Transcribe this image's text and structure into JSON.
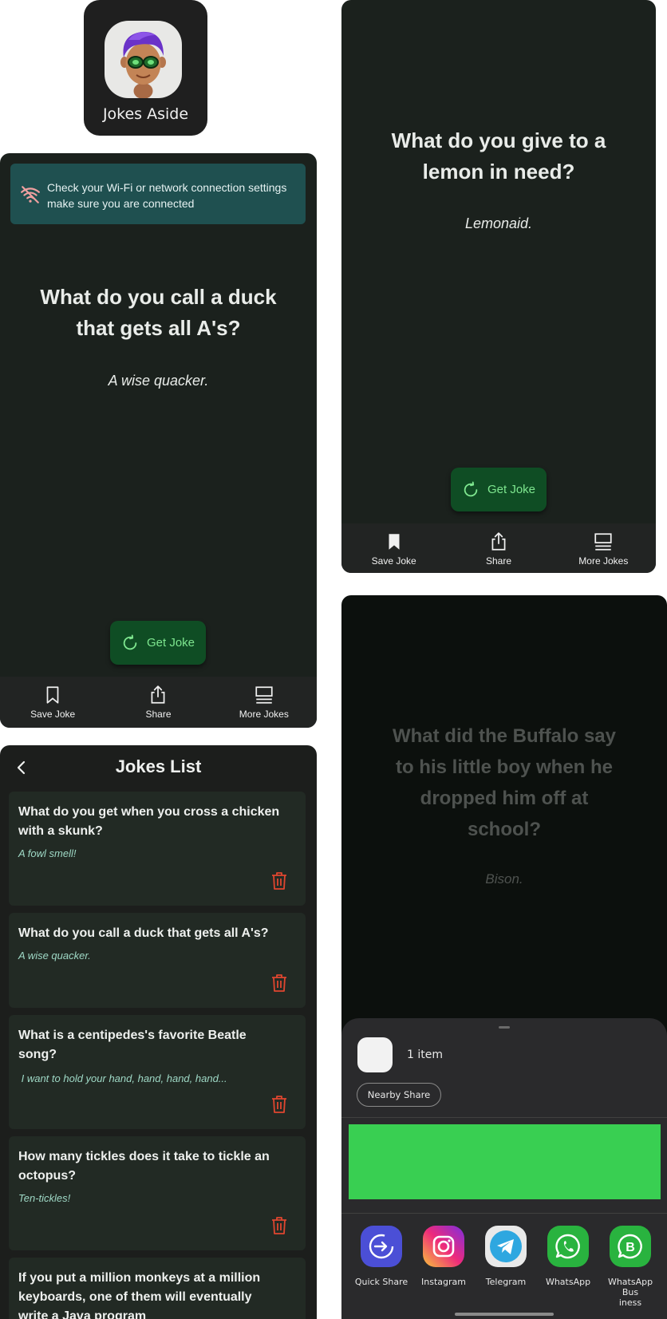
{
  "app_icon": {
    "name": "Jokes Aside"
  },
  "screen_offline": {
    "banner": {
      "line1": "Check your Wi-Fi or network connection settings",
      "line2": "make sure you are connected",
      "accent": "#f0a0a0"
    },
    "question_line1": "What do you call a duck",
    "question_line2": "that gets all A's?",
    "answer": "A wise quacker."
  },
  "screen_lemon": {
    "question_line1": "What do you give to a",
    "question_line2": "lemon in need?",
    "answer": "Lemonaid."
  },
  "get_joke_label": "Get Joke",
  "nav": {
    "save": "Save Joke",
    "share": "Share",
    "more": "More Jokes"
  },
  "jokes_list": {
    "title": "Jokes List",
    "items": [
      {
        "q1": "What do you get when you cross a chicken",
        "q2": "with a skunk?",
        "a": "A fowl smell!"
      },
      {
        "q1": "What do you call a duck that gets all A's?",
        "a": "A wise quacker."
      },
      {
        "q1": "What is a centipedes's favorite Beatle",
        "q2": "song?",
        "a": " I want to hold your hand, hand, hand, hand..."
      },
      {
        "q1": "How many tickles does it take to tickle an",
        "q2": "octopus?",
        "a": "Ten-tickles!"
      },
      {
        "q1": "If you put a million monkeys at a million",
        "q2": "keyboards, one of them will eventually",
        "q3": "write a Java program"
      }
    ]
  },
  "share_screen": {
    "question_line1": "What did the Buffalo say",
    "question_line2": "to his little boy when he",
    "question_line3": "dropped him off at",
    "question_line4": "school?",
    "answer": "Bison.",
    "sheet": {
      "count": "1 item",
      "nearby": "Nearby Share",
      "apps": [
        {
          "name": "Quick Share",
          "icon": "quick-share-icon"
        },
        {
          "name": "Instagram",
          "icon": "instagram-icon"
        },
        {
          "name": "Telegram",
          "icon": "telegram-icon"
        },
        {
          "name": "WhatsApp",
          "icon": "whatsapp-icon"
        },
        {
          "name1": "WhatsApp Bus",
          "name2": "iness",
          "icon": "whatsapp-business-icon"
        }
      ]
    }
  },
  "colors": {
    "background": "#1b211d",
    "button": "#0f4d24",
    "button_text": "#7ee68f",
    "trash": "#e0462f",
    "answer_list": "#9fd9c6"
  }
}
